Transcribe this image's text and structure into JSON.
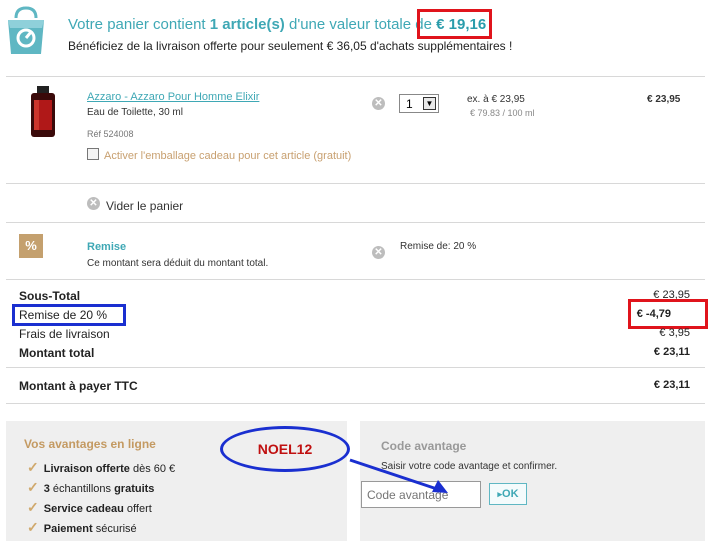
{
  "header": {
    "line1_prefix": "Votre panier contient",
    "item_count": "1 article(s)",
    "line1_middle": "d'une valeur totale de",
    "total_value": "€ 19,16",
    "line2": "Bénéficiez de la livraison offerte pour seulement € 36,05 d'achats supplémentaires !"
  },
  "product": {
    "name": "Azzaro - Azzaro Pour Homme Elixir",
    "desc": "Eau de Toilette, 30 ml",
    "ref": "Réf 524008",
    "gift_label": "Activer l'emballage cadeau pour cet article (gratuit)",
    "quantity": "1",
    "unit_price": "ex. à € 23,95",
    "per_unit": "€ 79.83 / 100 ml",
    "line_total": "€ 23,95"
  },
  "empty_cart_label": "Vider le panier",
  "discount": {
    "badge": "%",
    "title": "Remise",
    "desc": "Ce montant sera déduit du montant total.",
    "value": "Remise de: 20 %"
  },
  "totals": {
    "subtotal_label": "Sous-Total",
    "subtotal_value": "€ 23,95",
    "remise_label": "Remise de 20 %",
    "remise_value": "€ -4,79",
    "shipping_label": "Frais de livraison",
    "shipping_value": "€ 3,95",
    "total_label": "Montant total",
    "total_value": "€ 23,11",
    "pay_label": "Montant à payer TTC",
    "pay_value": "€ 23,11"
  },
  "advantages": {
    "title": "Vos avantages en ligne",
    "items": [
      {
        "bold": "Livraison offerte",
        "rest": " dès 60 €"
      },
      {
        "bold": "3",
        "rest": " échantillons ",
        "bold2": "gratuits"
      },
      {
        "bold": "Service cadeau",
        "rest": " offert"
      },
      {
        "bold": "Paiement",
        "rest": " sécurisé"
      }
    ]
  },
  "code": {
    "title": "Code avantage",
    "desc": "Saisir votre code avantage et confirmer.",
    "placeholder": "Code avantage",
    "ok_label": "OK"
  },
  "annotation": {
    "noel": "NOEL12"
  },
  "colors": {
    "accent": "#3fa8b5",
    "gold": "#c49a62",
    "red_box": "#e0141c",
    "blue_box": "#1a2fd0"
  }
}
